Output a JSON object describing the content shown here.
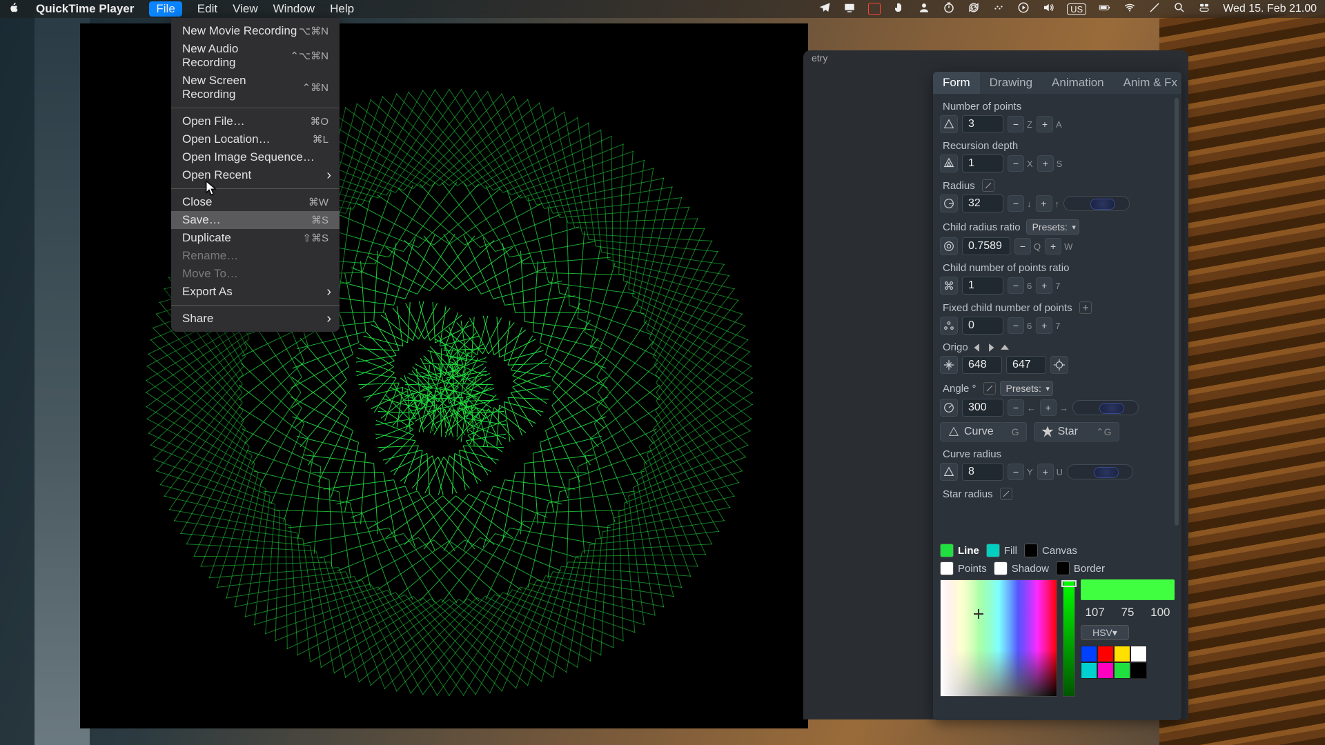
{
  "menubar": {
    "app_name": "QuickTime Player",
    "items": [
      "File",
      "Edit",
      "View",
      "Window",
      "Help"
    ],
    "active_item": "File",
    "input_lang": "US",
    "datetime": "Wed 15. Feb  21.00"
  },
  "file_menu": {
    "items": [
      {
        "label": "New Movie Recording",
        "shortcut": "⌥⌘N"
      },
      {
        "label": "New Audio Recording",
        "shortcut": "⌃⌥⌘N"
      },
      {
        "label": "New Screen Recording",
        "shortcut": "⌃⌘N"
      },
      {
        "sep": true
      },
      {
        "label": "Open File…",
        "shortcut": "⌘O"
      },
      {
        "label": "Open Location…",
        "shortcut": "⌘L"
      },
      {
        "label": "Open Image Sequence…",
        "shortcut": ""
      },
      {
        "label": "Open Recent",
        "shortcut": "",
        "submenu": true
      },
      {
        "sep": true
      },
      {
        "label": "Close",
        "shortcut": "⌘W"
      },
      {
        "label": "Save…",
        "shortcut": "⌘S",
        "hover": true
      },
      {
        "label": "Duplicate",
        "shortcut": "⇧⌘S"
      },
      {
        "label": "Rename…",
        "shortcut": "",
        "disabled": true
      },
      {
        "label": "Move To…",
        "shortcut": "",
        "disabled": true
      },
      {
        "label": "Export As",
        "shortcut": "",
        "submenu": true
      },
      {
        "sep": true
      },
      {
        "label": "Share",
        "shortcut": "",
        "submenu": true
      }
    ]
  },
  "panel_title": "etry",
  "tabs": {
    "items": [
      "Form",
      "Drawing",
      "Animation",
      "Anim & Fx"
    ],
    "active": 0
  },
  "params": {
    "num_points": {
      "label": "Number of points",
      "value": "3",
      "keys": [
        "Z",
        "A"
      ]
    },
    "recursion": {
      "label": "Recursion depth",
      "value": "1",
      "keys": [
        "X",
        "S"
      ]
    },
    "radius": {
      "label": "Radius",
      "value": "32",
      "keys": [
        "",
        ""
      ],
      "arrows": true
    },
    "child_ratio": {
      "label": "Child radius ratio",
      "value": "0.7589",
      "keys": [
        "Q",
        "W"
      ],
      "presets": "Presets:"
    },
    "child_points_ratio": {
      "label": "Child number of points ratio",
      "value": "1",
      "keys": [
        "6",
        "7"
      ]
    },
    "fixed_child_points": {
      "label": "Fixed child number of points",
      "value": "0",
      "keys": [
        "6",
        "7"
      ]
    },
    "origo": {
      "label": "Origo",
      "x": "648",
      "y": "647"
    },
    "angle": {
      "label": "Angle °",
      "value": "300",
      "presets": "Presets:"
    },
    "curve_btn": {
      "label": "Curve",
      "key": "G"
    },
    "star_btn": {
      "label": "Star",
      "key": "⌃G"
    },
    "curve_radius": {
      "label": "Curve radius",
      "value": "8",
      "keys": [
        "Y",
        "U"
      ]
    },
    "star_radius": {
      "label": "Star radius"
    }
  },
  "colors": {
    "line": {
      "label": "Line",
      "hex": "#20e040"
    },
    "fill": {
      "label": "Fill",
      "hex": "#00d0c0"
    },
    "canvas": {
      "label": "Canvas",
      "hex": "#000000"
    },
    "points": {
      "label": "Points",
      "hex": "#ffffff"
    },
    "shadow": {
      "label": "Shadow",
      "hex": "#ffffff"
    },
    "border": {
      "label": "Border",
      "hex": "#000000"
    },
    "hsv": {
      "h": "107",
      "s": "75",
      "v": "100",
      "mode": "HSV"
    },
    "presets": [
      "#0040ff",
      "#ff0000",
      "#ffe000",
      "#ffffff",
      "#00d0d0",
      "#ff00c0",
      "#20e040",
      "#000000"
    ]
  }
}
